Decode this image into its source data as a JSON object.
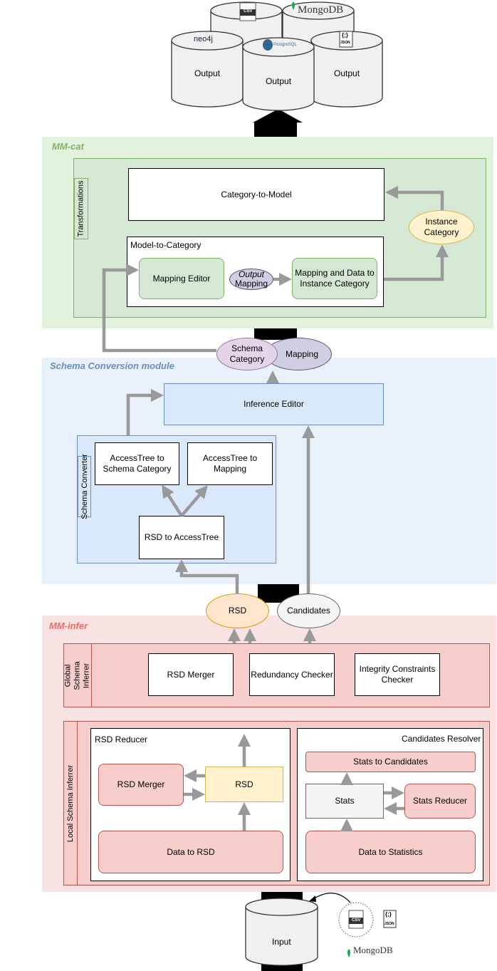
{
  "outputs": {
    "label": "Output",
    "logos": [
      "CSV",
      "MongoDB",
      "neo4j",
      "PostgreSQL",
      "{;}",
      "JSON"
    ]
  },
  "mmcat": {
    "title": "MM-cat",
    "transformations": "Transformations",
    "category_to_model": "Category-to-Model",
    "model_to_category": "Model-to-Category",
    "mapping_editor": "Mapping Editor",
    "output_mapping_1": "Output",
    "output_mapping_2": "Mapping",
    "mapping_and_data": "Mapping and Data to Instance Category",
    "instance_category": "Instance Category"
  },
  "interface": {
    "schema_category": "Schema Category",
    "mapping": "Mapping"
  },
  "conversion": {
    "title": "Schema Conversion module",
    "inference_editor": "Inference Editor",
    "schema_converter": "Schema Converter",
    "at_to_schema": "AccessTree to Schema Category",
    "at_to_mapping": "AccessTree to Mapping",
    "rsd_to_at": "RSD to AccessTree"
  },
  "interface2": {
    "rsd": "RSD",
    "candidates": "Candidates"
  },
  "infer": {
    "title": "MM-infer",
    "global": "Global Schema Inferrer",
    "rsd_merger": "RSD Merger",
    "redundancy": "Redundancy Checker",
    "integrity": "Integrity Constraints Checker",
    "local": "Local Schema Inferrer",
    "rsd_reducer": "RSD Reducer",
    "rr_merger": "RSD Merger",
    "rr_rsd": "RSD",
    "data_to_rsd": "Data to RSD",
    "candidates_resolver": "Candidates Resolver",
    "stats_to_candidates": "Stats to Candidates",
    "stats": "Stats",
    "stats_reducer": "Stats Reducer",
    "data_to_statistics": "Data to Statistics"
  },
  "input": {
    "label": "Input",
    "logos": [
      "CSV",
      "{;}",
      "JSON",
      "MongoDB"
    ]
  },
  "colors": {
    "green_section": "#e2f3dd",
    "blue_section": "#e8f0fa",
    "red_section": "#f8e2e2",
    "arrow": "#999999",
    "title_green": "#82b366",
    "title_blue": "#6c8ebf",
    "title_red": "#ea6b66"
  }
}
